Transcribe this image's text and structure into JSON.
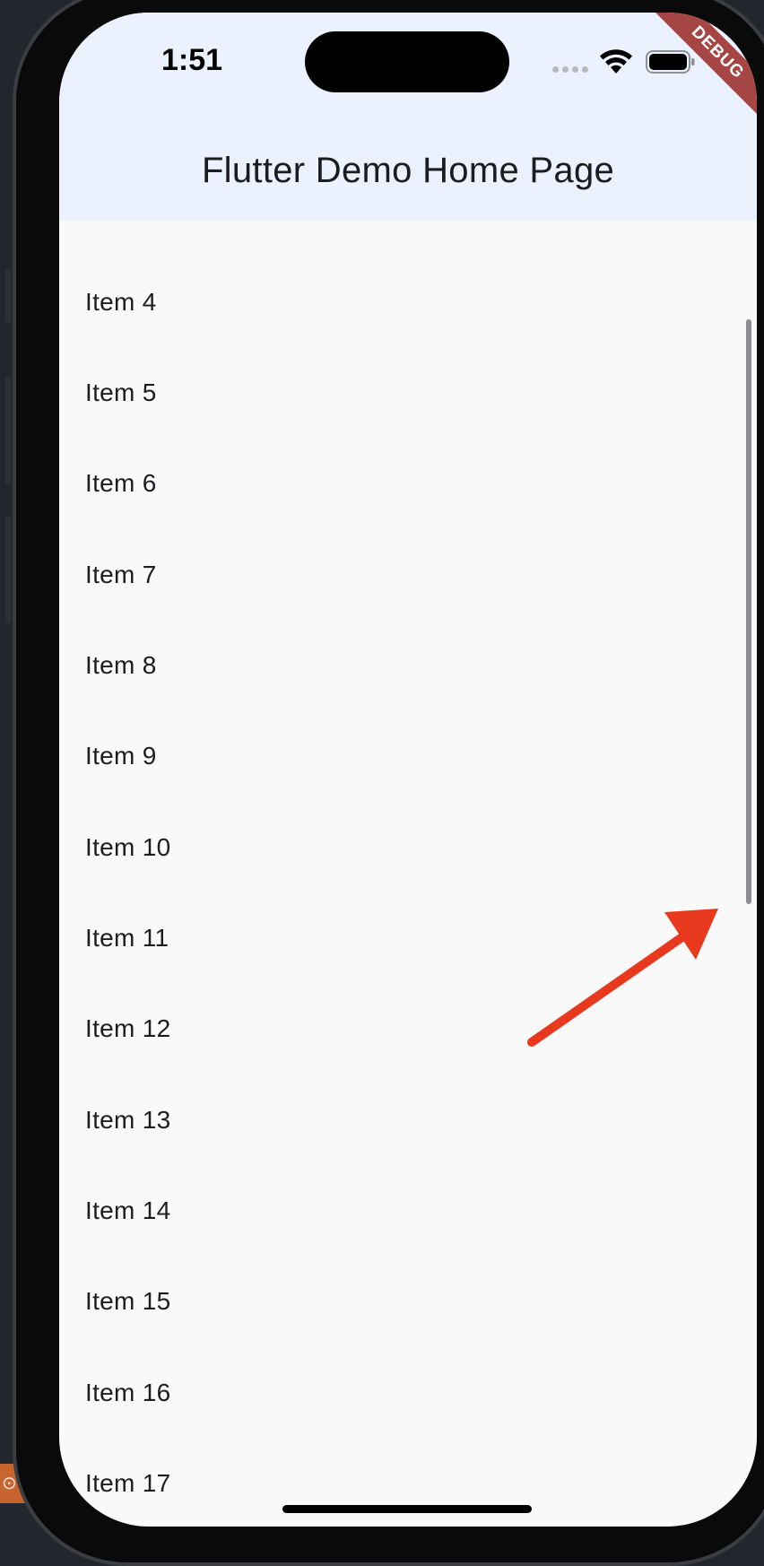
{
  "status_bar": {
    "time": "1:51",
    "icons": [
      "cellular-dots-icon",
      "wifi-icon",
      "battery-icon"
    ]
  },
  "debug_banner": "DEBUG",
  "app_bar": {
    "title": "Flutter Demo Home Page"
  },
  "list": {
    "items": [
      "Item 4",
      "Item 5",
      "Item 6",
      "Item 7",
      "Item 8",
      "Item 9",
      "Item 10",
      "Item 11",
      "Item 12",
      "Item 13",
      "Item 14",
      "Item 15",
      "Item 16",
      "Item 17"
    ]
  },
  "colors": {
    "app_bar_bg": "#ebf2fd",
    "body_bg": "#f9f9f9",
    "debug_banner": "#a54644",
    "annotation_arrow": "#e8381e"
  }
}
